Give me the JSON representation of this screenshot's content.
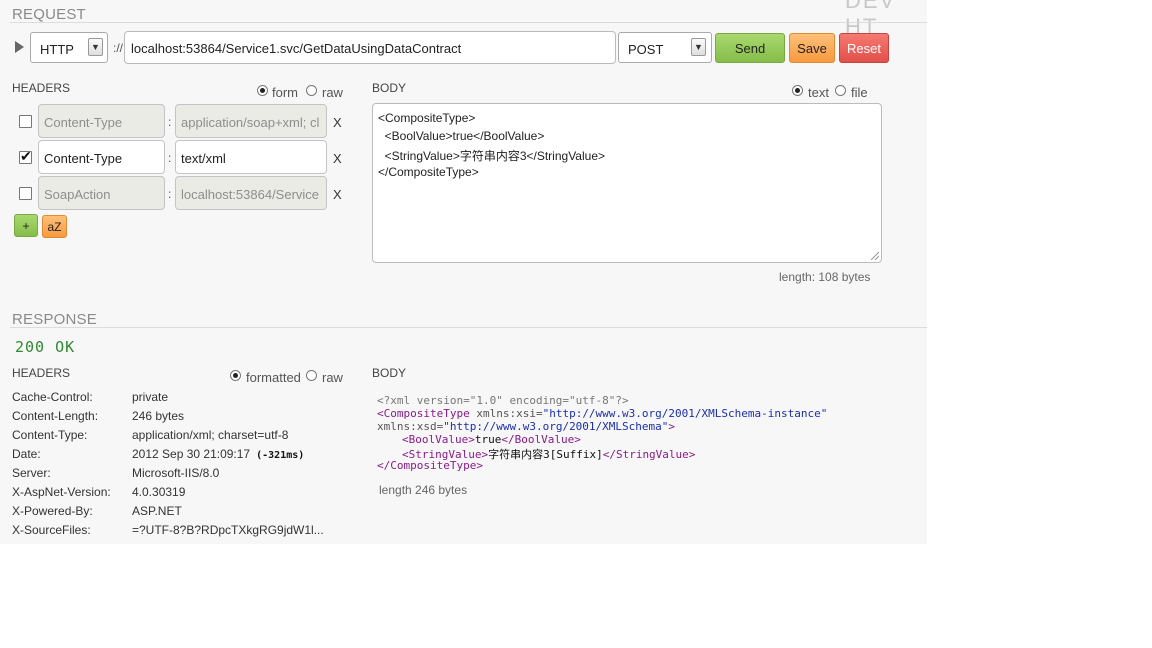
{
  "app": {
    "corner_title": "DEV HT"
  },
  "request": {
    "section_title": "REQUEST",
    "protocol": "HTTP",
    "separator": "://",
    "url": "localhost:53864/Service1.svc/GetDataUsingDataContract",
    "method": "POST",
    "buttons": {
      "send": "Send",
      "save": "Save",
      "reset": "Reset",
      "add": "+",
      "sort": "aZ"
    },
    "headers_label": "HEADERS",
    "headers_mode": {
      "form": "form",
      "raw": "raw",
      "selected": "form"
    },
    "headers": [
      {
        "checked": false,
        "name": "Content-Type",
        "value": "application/soap+xml; cl",
        "disabled": true
      },
      {
        "checked": true,
        "name": "Content-Type",
        "value": "text/xml",
        "disabled": false
      },
      {
        "checked": false,
        "name": "SoapAction",
        "value": "localhost:53864/Service",
        "disabled": true
      }
    ],
    "colon": ":",
    "remove": "X",
    "body_label": "BODY",
    "body_mode": {
      "text": "text",
      "file": "file",
      "selected": "text"
    },
    "body_lines": [
      "<CompositeType>",
      "  <BoolValue>true</BoolValue>",
      "  <StringValue>字符串内容3</StringValue>",
      "</CompositeType>"
    ],
    "length": "length: 108 bytes"
  },
  "response": {
    "section_title": "RESPONSE",
    "status": "200 OK",
    "headers_label": "HEADERS",
    "headers_mode": {
      "formatted": "formatted",
      "raw": "raw",
      "selected": "formatted"
    },
    "headers": [
      {
        "key": "Cache-Control:",
        "value": "private"
      },
      {
        "key": "Content-Length:",
        "value": "246 bytes"
      },
      {
        "key": "Content-Type:",
        "value": "application/xml; charset=utf-8"
      },
      {
        "key": "Date:",
        "value": "2012 Sep 30 21:09:17",
        "extra": "(-321ms)"
      },
      {
        "key": "Server:",
        "value": "Microsoft-IIS/8.0"
      },
      {
        "key": "X-AspNet-Version:",
        "value": "4.0.30319"
      },
      {
        "key": "X-Powered-By:",
        "value": "ASP.NET"
      },
      {
        "key": "X-SourceFiles:",
        "value": "=?UTF-8?B?RDpcTXkgRG9jdW1l..."
      }
    ],
    "body_label": "BODY",
    "body_xml": {
      "decl": "<?xml version=\"1.0\" encoding=\"utf-8\"?>",
      "root_open": "<CompositeType",
      "attr1_name": " xmlns:xsi=",
      "attr1_value": "\"http://www.w3.org/2001/XMLSchema-instance\"",
      "attr2_name": "xmlns:xsd=",
      "attr2_value": "\"http://www.w3.org/2001/XMLSchema\"",
      "root_open_end": ">",
      "bool_open": "<BoolValue>",
      "bool_value": "true",
      "bool_close": "</BoolValue>",
      "string_open": "<StringValue>",
      "string_value": "字符串内容3[Suffix]",
      "string_close": "</StringValue>",
      "root_close": "</CompositeType>"
    },
    "length": "length 246 bytes"
  }
}
